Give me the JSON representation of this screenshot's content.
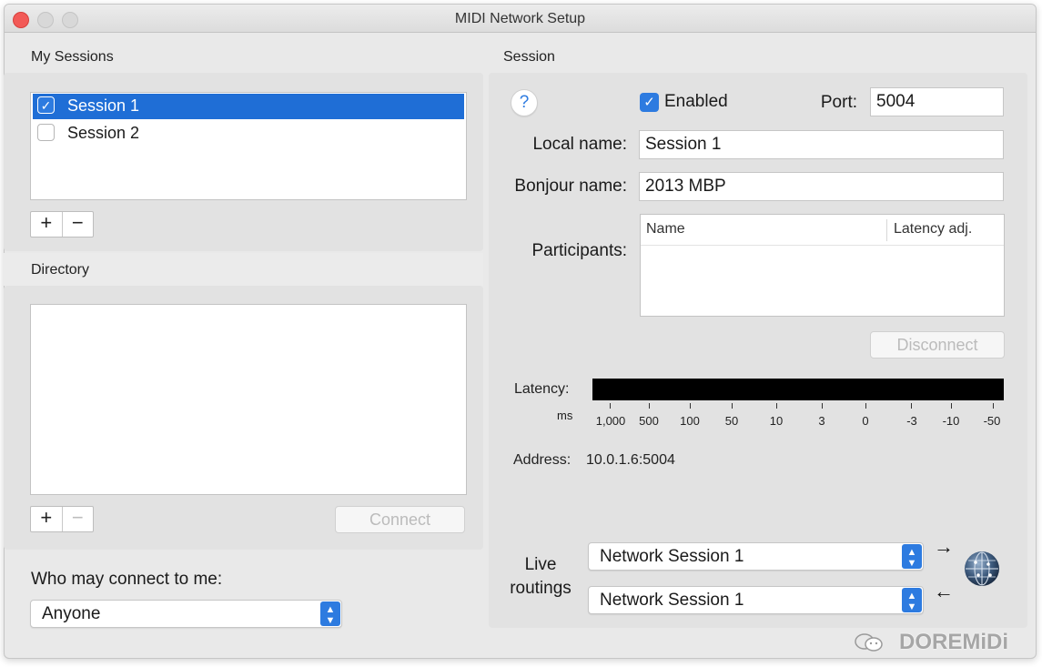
{
  "window": {
    "title": "MIDI Network Setup"
  },
  "my_sessions": {
    "label": "My Sessions",
    "items": [
      {
        "label": "Session 1",
        "checked": true,
        "selected": true
      },
      {
        "label": "Session 2",
        "checked": false,
        "selected": false
      }
    ],
    "add": "+",
    "remove": "−"
  },
  "directory": {
    "label": "Directory",
    "add": "+",
    "remove": "−",
    "connect_button": "Connect"
  },
  "access": {
    "label": "Who may connect to me:",
    "selected": "Anyone"
  },
  "session": {
    "label": "Session",
    "help": "?",
    "enabled_label": "Enabled",
    "enabled": true,
    "port_label": "Port:",
    "port_value": "5004",
    "local_name_label": "Local name:",
    "local_name_value": "Session 1",
    "bonjour_name_label": "Bonjour name:",
    "bonjour_name_value": "2013 MBP",
    "participants_label": "Participants:",
    "participants_columns": [
      "Name",
      "Latency adj."
    ],
    "disconnect_button": "Disconnect",
    "latency_label": "Latency:",
    "latency_unit": "ms",
    "latency_ticks": [
      "1,000",
      "500",
      "100",
      "50",
      "10",
      "3",
      "0",
      "-3",
      "-10",
      "-50"
    ],
    "address_label": "Address:",
    "address_value": "10.0.1.6:5004",
    "live_label": "Live",
    "routings_label": "routings",
    "routing_out": "Network Session 1",
    "routing_in": "Network Session 1",
    "arrow_out": "→",
    "arrow_in": "←"
  },
  "watermark": {
    "text": "DOREMiDi"
  },
  "colors": {
    "accent": "#2d7be0",
    "selection": "#1f6ed6",
    "close": "#f25a57"
  }
}
